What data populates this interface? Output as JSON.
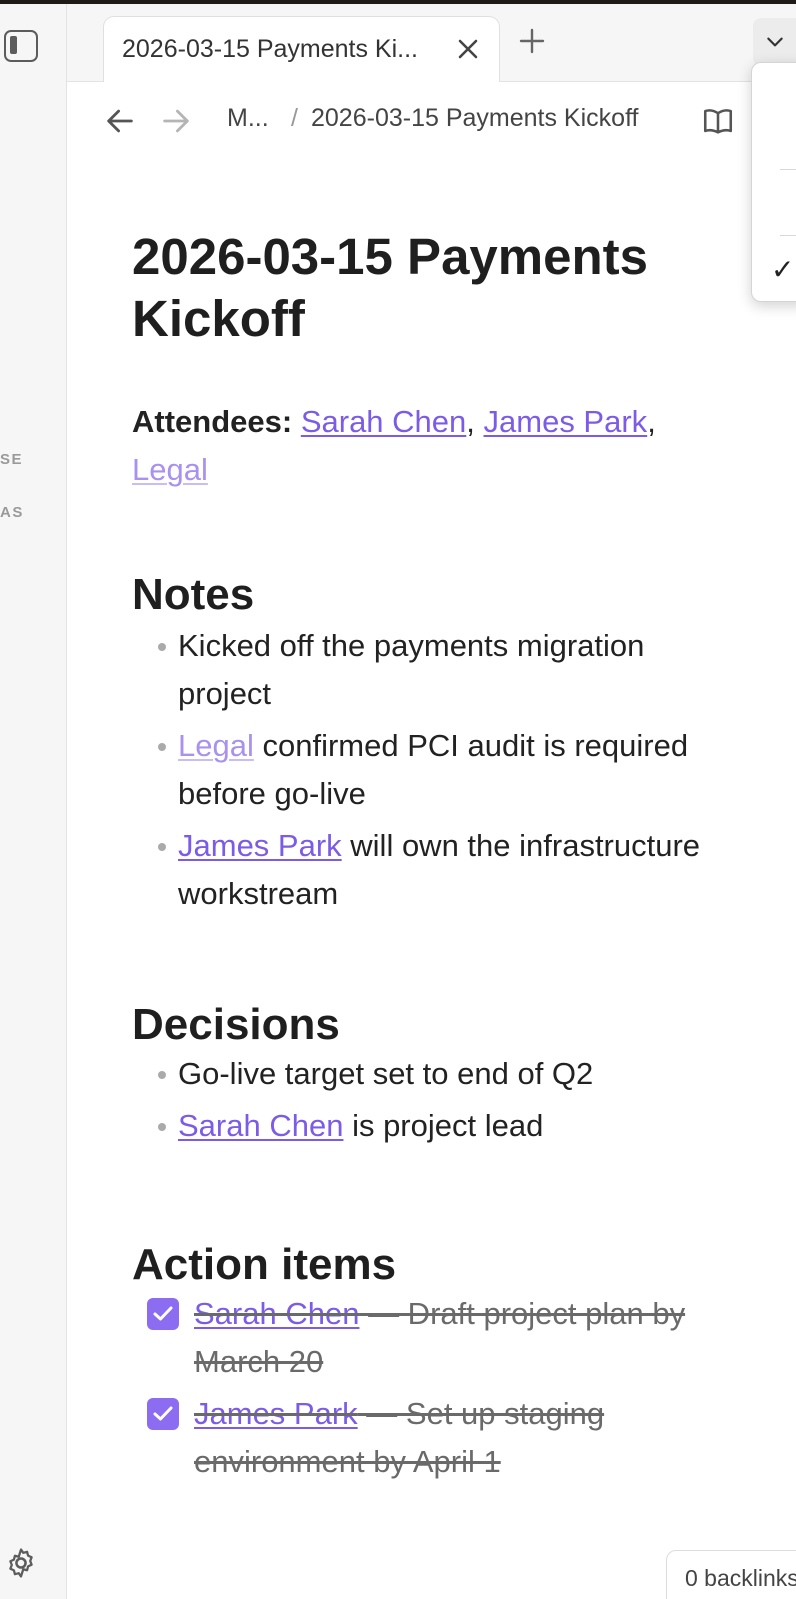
{
  "sidebar": {
    "fragments": [
      "SE",
      "AS"
    ]
  },
  "tabbar": {
    "active_tab_title": "2026-03-15 Payments Ki...",
    "new_tab_symbol": "+"
  },
  "navbar": {
    "breadcrumb_parent": "M...",
    "breadcrumb_separator": "/",
    "breadcrumb_current": "2026-03-15 Payments Kickoff"
  },
  "menu": {
    "check": "✓"
  },
  "note": {
    "title": "2026-03-15 Payments Kickoff",
    "attendees_label": "Attendees:",
    "attendees": [
      {
        "name": "Sarah Chen",
        "resolved": true
      },
      {
        "name": "James Park",
        "resolved": true
      },
      {
        "name": "Legal",
        "resolved": false
      }
    ],
    "notes_heading": "Notes",
    "notes": [
      {
        "link": "",
        "text": "Kicked off the payments migration project"
      },
      {
        "link": "Legal",
        "text": " confirmed PCI audit is required before go-live"
      },
      {
        "link": "James Park",
        "text": " will own the infrastructure workstream"
      }
    ],
    "decisions_heading": "Decisions",
    "decisions": [
      {
        "link": "",
        "text": "Go-live target set to end of Q2"
      },
      {
        "link": "Sarah Chen",
        "text": " is project lead"
      }
    ],
    "action_items_heading": "Action items",
    "action_items": [
      {
        "link": "Sarah Chen",
        "text": " — Draft project plan by March 20",
        "checked": true
      },
      {
        "link": "James Park",
        "text": " — Set up staging environment by April 1",
        "checked": true
      }
    ]
  },
  "footer": {
    "backlinks": "0 backlinks"
  },
  "colors": {
    "accent": "#7c5ce6",
    "checkbox": "#8c6cf0",
    "unresolved_link": "#a892ee"
  }
}
